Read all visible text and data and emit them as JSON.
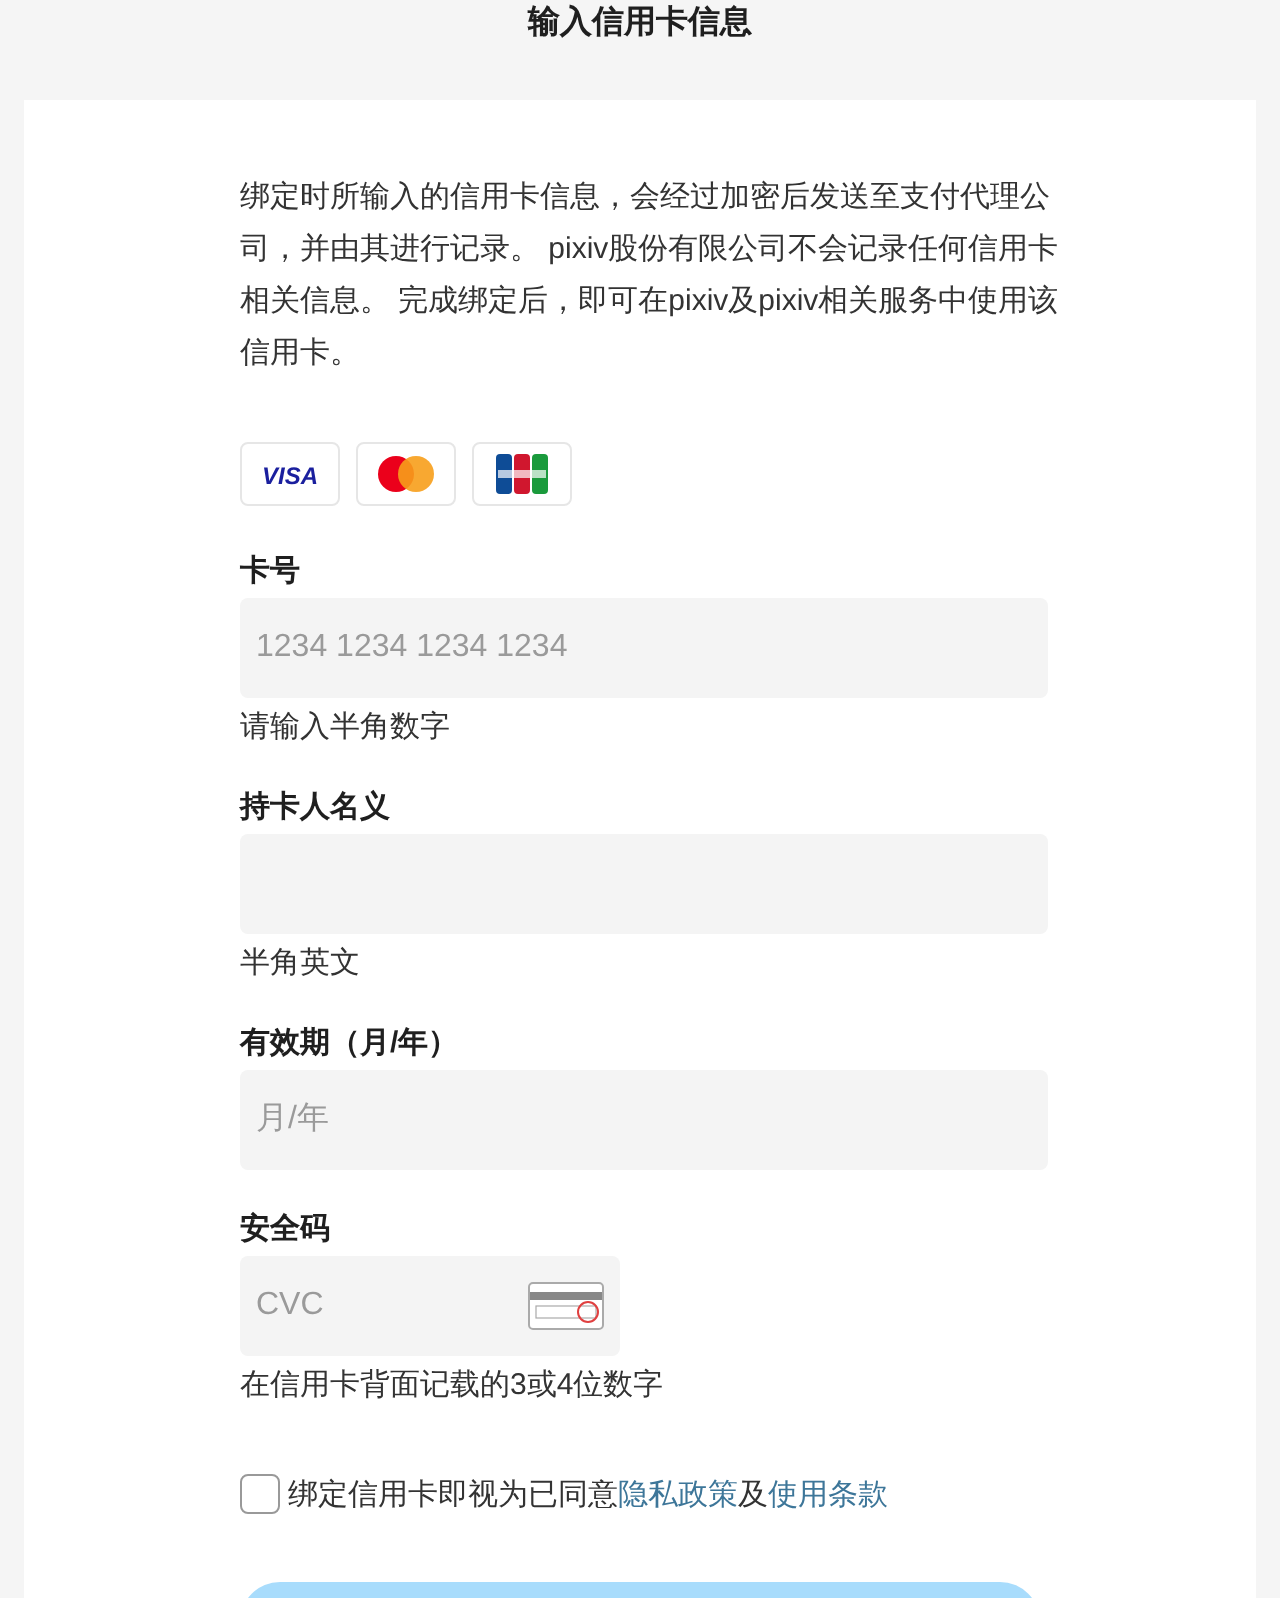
{
  "header": {
    "title": "输入信用卡信息"
  },
  "intro": "绑定时所输入的信用卡信息，会经过加密后发送至支付代理公司，并由其进行记录。 pixiv股份有限公司不会记录任何信用卡相关信息。 完成绑定后，即可在pixiv及pixiv相关服务中使用该信用卡。",
  "card_brands": [
    {
      "kind": "visa",
      "label": "VISA"
    },
    {
      "kind": "mastercard"
    },
    {
      "kind": "jcb"
    }
  ],
  "fields": [
    {
      "label": "卡号",
      "placeholder": "1234 1234 1234 1234",
      "hint": "请输入半角数字",
      "kind": "wide"
    },
    {
      "label": "持卡人名义",
      "hint": "半角英文",
      "kind": "wide"
    },
    {
      "label": "有效期（月/年）",
      "placeholder": "月/年",
      "kind": "wide"
    },
    {
      "label": "安全码",
      "placeholder": "CVC",
      "hint": "在信用卡背面记载的3或4位数字",
      "kind": "cvc"
    }
  ],
  "agreement": {
    "checked": false,
    "parts": [
      {
        "kind": "text",
        "text": "绑定信用卡即视为已同意"
      },
      {
        "kind": "link",
        "text": "隐私政策"
      },
      {
        "kind": "text",
        "text": "及"
      },
      {
        "kind": "link",
        "text": "使用条款"
      }
    ]
  },
  "submit_button": {
    "disabled": true
  }
}
